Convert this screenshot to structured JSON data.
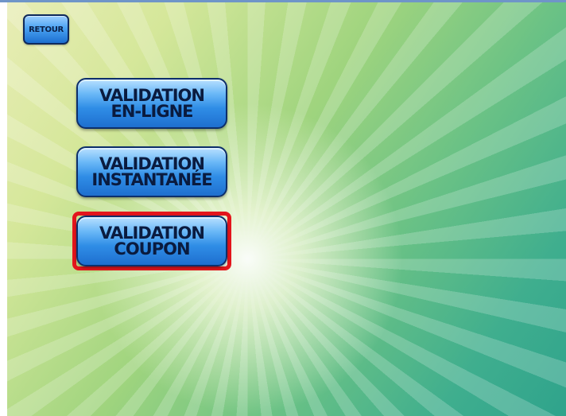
{
  "header": {
    "back_label": "RETOUR"
  },
  "menu": {
    "items": [
      {
        "line1": "VALIDATION",
        "line2": "EN-LIGNE"
      },
      {
        "line1": "VALIDATION",
        "line2": "INSTANTANÉE"
      },
      {
        "line1": "VALIDATION",
        "line2": "COUPON"
      }
    ],
    "selected_index": 2
  },
  "colors": {
    "button_blue": "#2f8de6",
    "button_border": "#0d2f6b",
    "selection_red": "#e3151c",
    "background_green": "#3fae8e"
  }
}
